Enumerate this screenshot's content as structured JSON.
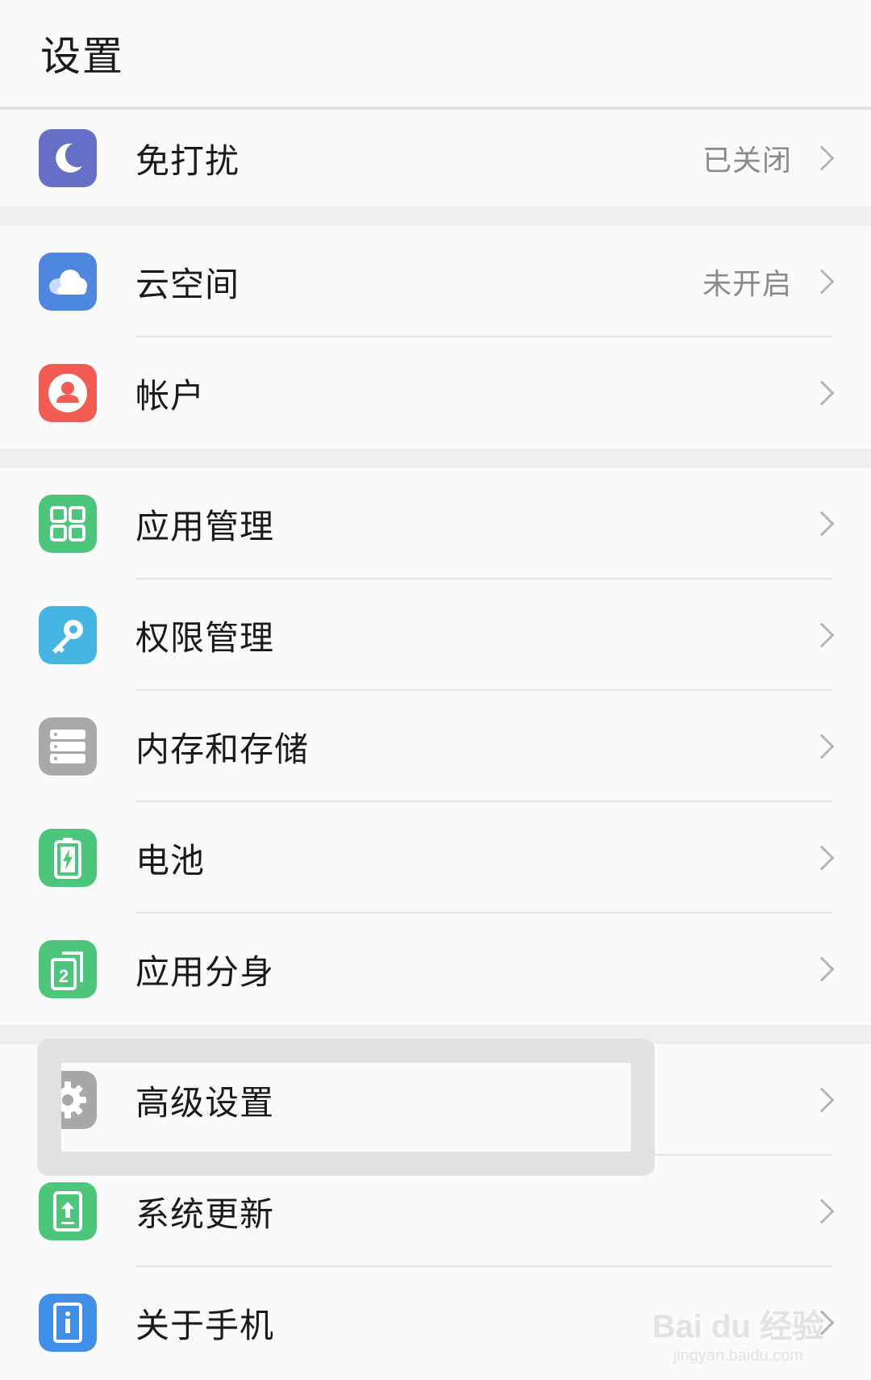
{
  "header": {
    "title": "设置"
  },
  "colors": {
    "moon": "#6470c6",
    "cloud": "#4f86e0",
    "account": "#f25a52",
    "green": "#4cc67a",
    "key": "#45b6e4",
    "storage": "#a9a9a9",
    "gear": "#a8a8a8",
    "phone": "#3f8fe8"
  },
  "rows": {
    "dnd": {
      "label": "免打扰",
      "status": "已关闭",
      "icon": "moon-icon"
    },
    "cloud": {
      "label": "云空间",
      "status": "未开启",
      "icon": "cloud-icon"
    },
    "account": {
      "label": "帐户",
      "icon": "user-icon"
    },
    "apps": {
      "label": "应用管理",
      "icon": "grid-icon"
    },
    "permissions": {
      "label": "权限管理",
      "icon": "key-icon"
    },
    "storage": {
      "label": "内存和存储",
      "icon": "storage-icon"
    },
    "battery": {
      "label": "电池",
      "icon": "battery-icon"
    },
    "twin": {
      "label": "应用分身",
      "icon": "twin-app-icon"
    },
    "advanced": {
      "label": "高级设置",
      "icon": "gear-icon"
    },
    "update": {
      "label": "系统更新",
      "icon": "update-icon"
    },
    "about": {
      "label": "关于手机",
      "icon": "info-icon"
    }
  },
  "watermark": {
    "main": "Bai du 经验",
    "sub": "jingyan.baidu.com"
  }
}
